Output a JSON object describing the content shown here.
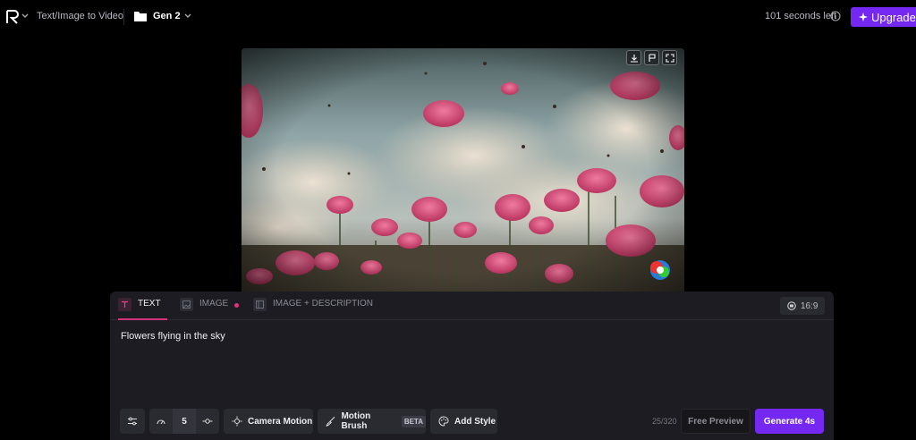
{
  "topbar": {
    "app_label": "Text/Image to Video",
    "project_name": "Gen 2",
    "seconds_left": "101 seconds left",
    "upgrade_label": "Upgrade"
  },
  "tabs": [
    {
      "label": "TEXT",
      "active": true
    },
    {
      "label": "IMAGE",
      "has_dot": true
    },
    {
      "label": "IMAGE + DESCRIPTION"
    }
  ],
  "aspect_ratio": "16:9",
  "prompt_text": "Flowers flying in the sky",
  "toolbar": {
    "motion_value": "5",
    "camera_motion_label": "Camera Motion",
    "motion_brush_label": "Motion Brush",
    "beta_badge": "BETA",
    "add_style_label": "Add Style",
    "char_count": "25/320",
    "free_preview_label": "Free Preview",
    "generate_label": "Generate 4s"
  },
  "colors": {
    "accent": "#7428f1",
    "active_tab": "#d3357a",
    "panel_bg": "#1c1c22"
  },
  "icons": [
    "runway-logo-icon",
    "chevron-down-icon",
    "folder-icon",
    "info-icon",
    "sparkle-icon",
    "download-icon",
    "flag-icon",
    "fullscreen-icon",
    "text-icon",
    "image-icon",
    "image-description-icon",
    "aspect-ratio-icon",
    "settings-sliders-icon",
    "speed-icon",
    "motion-knob-icon",
    "camera-motion-icon",
    "brush-icon",
    "palette-icon"
  ]
}
